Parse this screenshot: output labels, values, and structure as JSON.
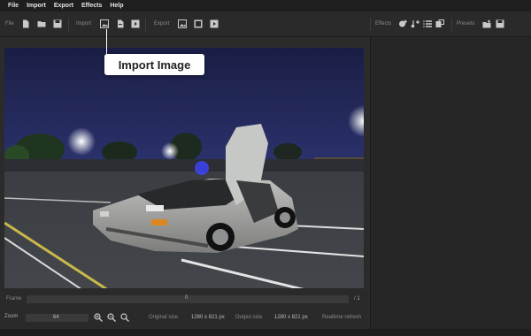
{
  "menu": [
    "File",
    "Import",
    "Export",
    "Effects",
    "Help"
  ],
  "toolbar": {
    "file_label": "File",
    "import_label": "Import",
    "export_label": "Export",
    "effects_label": "Effects",
    "presets_label": "Presets"
  },
  "tooltip": "Import Image",
  "bottom": {
    "frame_label": "Frame",
    "frame_value": "0",
    "frame_total": "/ 1",
    "zoom_label": "Zoom",
    "zoom_value": "64",
    "original_size_label": "Original size",
    "original_size_value": "1280 x 821 px",
    "output_size_label": "Output size",
    "output_size_value": "1280 x 821 px",
    "realtime_label": "Realtime refresh"
  },
  "colors": {
    "accent": "#ffffff",
    "background": "#2b2b2b"
  }
}
